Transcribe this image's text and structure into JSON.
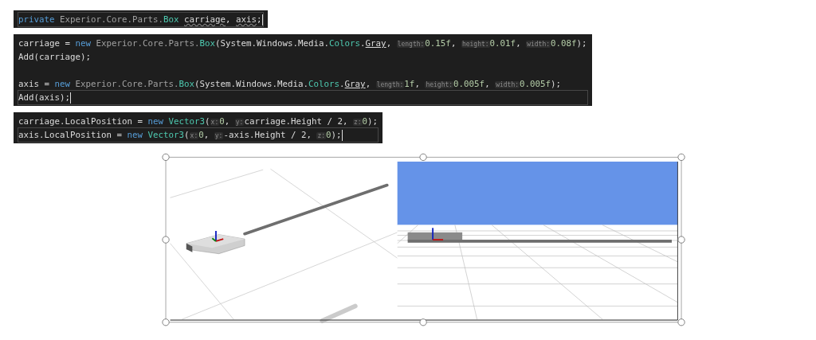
{
  "code_blocks": [
    {
      "lines": [
        {
          "kind": "code",
          "current": true,
          "tokens": [
            {
              "kind": "keyword",
              "text": "private"
            },
            {
              "kind": "dim",
              "text": " Experior.Core.Parts."
            },
            {
              "kind": "type",
              "text": "Box "
            },
            {
              "kind": "squiggle",
              "text": "carriage"
            },
            {
              "kind": "plain",
              "text": ", "
            },
            {
              "kind": "squiggle",
              "text": "axis"
            },
            {
              "kind": "plain",
              "text": ";"
            }
          ]
        }
      ]
    },
    {
      "lines": [
        {
          "kind": "code",
          "current": false,
          "tokens": [
            {
              "kind": "plain",
              "text": "carriage = "
            },
            {
              "kind": "keyword",
              "text": "new"
            },
            {
              "kind": "dim",
              "text": " Experior.Core.Parts."
            },
            {
              "kind": "type",
              "text": "Box"
            },
            {
              "kind": "plain",
              "text": "(System.Windows.Media."
            },
            {
              "kind": "type",
              "text": "Colors"
            },
            {
              "kind": "plain",
              "text": "."
            },
            {
              "kind": "underline",
              "text": "Gray"
            },
            {
              "kind": "plain",
              "text": ", "
            },
            {
              "kind": "hint",
              "text": "length:"
            },
            {
              "kind": "number",
              "text": "0.15f"
            },
            {
              "kind": "plain",
              "text": ", "
            },
            {
              "kind": "hint",
              "text": "height:"
            },
            {
              "kind": "number",
              "text": "0.01f"
            },
            {
              "kind": "plain",
              "text": ", "
            },
            {
              "kind": "hint",
              "text": "width:"
            },
            {
              "kind": "number",
              "text": "0.08f"
            },
            {
              "kind": "plain",
              "text": ");"
            }
          ]
        },
        {
          "kind": "code",
          "current": false,
          "tokens": [
            {
              "kind": "plain",
              "text": "Add(carriage);"
            }
          ]
        },
        {
          "kind": "blank"
        },
        {
          "kind": "code",
          "current": false,
          "tokens": [
            {
              "kind": "plain",
              "text": "axis = "
            },
            {
              "kind": "keyword",
              "text": "new"
            },
            {
              "kind": "dim",
              "text": " Experior.Core.Parts."
            },
            {
              "kind": "type",
              "text": "Box"
            },
            {
              "kind": "plain",
              "text": "(System.Windows.Media."
            },
            {
              "kind": "type",
              "text": "Colors"
            },
            {
              "kind": "plain",
              "text": "."
            },
            {
              "kind": "underline",
              "text": "Gray"
            },
            {
              "kind": "plain",
              "text": ", "
            },
            {
              "kind": "hint",
              "text": "length:"
            },
            {
              "kind": "number",
              "text": "1f"
            },
            {
              "kind": "plain",
              "text": ", "
            },
            {
              "kind": "hint",
              "text": "height:"
            },
            {
              "kind": "number",
              "text": "0.005f"
            },
            {
              "kind": "plain",
              "text": ", "
            },
            {
              "kind": "hint",
              "text": "width:"
            },
            {
              "kind": "number",
              "text": "0.005f"
            },
            {
              "kind": "plain",
              "text": ");"
            }
          ]
        },
        {
          "kind": "code",
          "current": true,
          "tokens": [
            {
              "kind": "plain",
              "text": "Add(axis);"
            }
          ]
        }
      ]
    },
    {
      "lines": [
        {
          "kind": "code",
          "current": false,
          "tokens": [
            {
              "kind": "plain",
              "text": "carriage.LocalPosition = "
            },
            {
              "kind": "keyword",
              "text": "new "
            },
            {
              "kind": "type",
              "text": "Vector3"
            },
            {
              "kind": "plain",
              "text": "("
            },
            {
              "kind": "hint",
              "text": "x:"
            },
            {
              "kind": "number",
              "text": "0"
            },
            {
              "kind": "plain",
              "text": ", "
            },
            {
              "kind": "hint",
              "text": "y:"
            },
            {
              "kind": "plain",
              "text": "carriage.Height / 2, "
            },
            {
              "kind": "hint",
              "text": "z:"
            },
            {
              "kind": "number",
              "text": "0"
            },
            {
              "kind": "plain",
              "text": ");"
            }
          ]
        },
        {
          "kind": "code",
          "current": true,
          "tokens": [
            {
              "kind": "plain",
              "text": "axis.LocalPosition = "
            },
            {
              "kind": "keyword",
              "text": "new "
            },
            {
              "kind": "type",
              "text": "Vector3"
            },
            {
              "kind": "plain",
              "text": "("
            },
            {
              "kind": "hint",
              "text": "x:"
            },
            {
              "kind": "number",
              "text": "0"
            },
            {
              "kind": "plain",
              "text": ", "
            },
            {
              "kind": "hint",
              "text": "y:"
            },
            {
              "kind": "plain",
              "text": "-axis.Height / 2, "
            },
            {
              "kind": "hint",
              "text": "z:"
            },
            {
              "kind": "number",
              "text": "0"
            },
            {
              "kind": "plain",
              "text": ");"
            }
          ]
        }
      ]
    }
  ]
}
